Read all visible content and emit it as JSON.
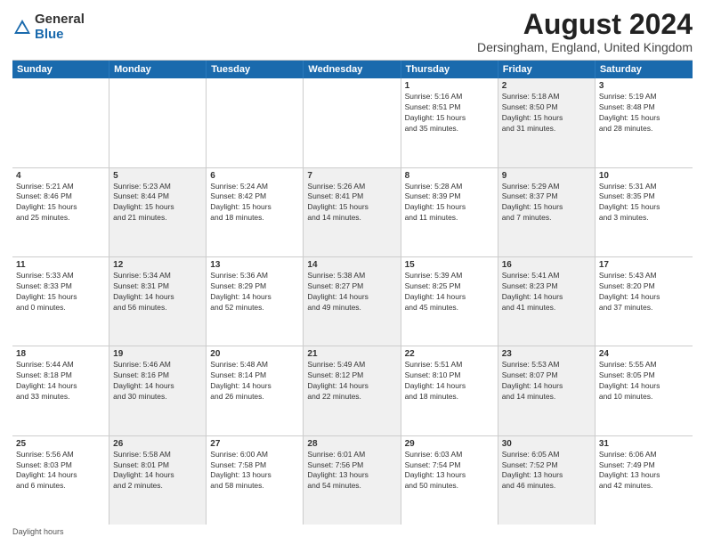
{
  "logo": {
    "general": "General",
    "blue": "Blue"
  },
  "title": "August 2024",
  "subtitle": "Dersingham, England, United Kingdom",
  "daylight_label": "Daylight hours",
  "headers": [
    "Sunday",
    "Monday",
    "Tuesday",
    "Wednesday",
    "Thursday",
    "Friday",
    "Saturday"
  ],
  "rows": [
    [
      {
        "day": "",
        "text": "",
        "alt": false
      },
      {
        "day": "",
        "text": "",
        "alt": false
      },
      {
        "day": "",
        "text": "",
        "alt": false
      },
      {
        "day": "",
        "text": "",
        "alt": false
      },
      {
        "day": "1",
        "text": "Sunrise: 5:16 AM\nSunset: 8:51 PM\nDaylight: 15 hours\nand 35 minutes.",
        "alt": false
      },
      {
        "day": "2",
        "text": "Sunrise: 5:18 AM\nSunset: 8:50 PM\nDaylight: 15 hours\nand 31 minutes.",
        "alt": true
      },
      {
        "day": "3",
        "text": "Sunrise: 5:19 AM\nSunset: 8:48 PM\nDaylight: 15 hours\nand 28 minutes.",
        "alt": false
      }
    ],
    [
      {
        "day": "4",
        "text": "Sunrise: 5:21 AM\nSunset: 8:46 PM\nDaylight: 15 hours\nand 25 minutes.",
        "alt": false
      },
      {
        "day": "5",
        "text": "Sunrise: 5:23 AM\nSunset: 8:44 PM\nDaylight: 15 hours\nand 21 minutes.",
        "alt": true
      },
      {
        "day": "6",
        "text": "Sunrise: 5:24 AM\nSunset: 8:42 PM\nDaylight: 15 hours\nand 18 minutes.",
        "alt": false
      },
      {
        "day": "7",
        "text": "Sunrise: 5:26 AM\nSunset: 8:41 PM\nDaylight: 15 hours\nand 14 minutes.",
        "alt": true
      },
      {
        "day": "8",
        "text": "Sunrise: 5:28 AM\nSunset: 8:39 PM\nDaylight: 15 hours\nand 11 minutes.",
        "alt": false
      },
      {
        "day": "9",
        "text": "Sunrise: 5:29 AM\nSunset: 8:37 PM\nDaylight: 15 hours\nand 7 minutes.",
        "alt": true
      },
      {
        "day": "10",
        "text": "Sunrise: 5:31 AM\nSunset: 8:35 PM\nDaylight: 15 hours\nand 3 minutes.",
        "alt": false
      }
    ],
    [
      {
        "day": "11",
        "text": "Sunrise: 5:33 AM\nSunset: 8:33 PM\nDaylight: 15 hours\nand 0 minutes.",
        "alt": false
      },
      {
        "day": "12",
        "text": "Sunrise: 5:34 AM\nSunset: 8:31 PM\nDaylight: 14 hours\nand 56 minutes.",
        "alt": true
      },
      {
        "day": "13",
        "text": "Sunrise: 5:36 AM\nSunset: 8:29 PM\nDaylight: 14 hours\nand 52 minutes.",
        "alt": false
      },
      {
        "day": "14",
        "text": "Sunrise: 5:38 AM\nSunset: 8:27 PM\nDaylight: 14 hours\nand 49 minutes.",
        "alt": true
      },
      {
        "day": "15",
        "text": "Sunrise: 5:39 AM\nSunset: 8:25 PM\nDaylight: 14 hours\nand 45 minutes.",
        "alt": false
      },
      {
        "day": "16",
        "text": "Sunrise: 5:41 AM\nSunset: 8:23 PM\nDaylight: 14 hours\nand 41 minutes.",
        "alt": true
      },
      {
        "day": "17",
        "text": "Sunrise: 5:43 AM\nSunset: 8:20 PM\nDaylight: 14 hours\nand 37 minutes.",
        "alt": false
      }
    ],
    [
      {
        "day": "18",
        "text": "Sunrise: 5:44 AM\nSunset: 8:18 PM\nDaylight: 14 hours\nand 33 minutes.",
        "alt": false
      },
      {
        "day": "19",
        "text": "Sunrise: 5:46 AM\nSunset: 8:16 PM\nDaylight: 14 hours\nand 30 minutes.",
        "alt": true
      },
      {
        "day": "20",
        "text": "Sunrise: 5:48 AM\nSunset: 8:14 PM\nDaylight: 14 hours\nand 26 minutes.",
        "alt": false
      },
      {
        "day": "21",
        "text": "Sunrise: 5:49 AM\nSunset: 8:12 PM\nDaylight: 14 hours\nand 22 minutes.",
        "alt": true
      },
      {
        "day": "22",
        "text": "Sunrise: 5:51 AM\nSunset: 8:10 PM\nDaylight: 14 hours\nand 18 minutes.",
        "alt": false
      },
      {
        "day": "23",
        "text": "Sunrise: 5:53 AM\nSunset: 8:07 PM\nDaylight: 14 hours\nand 14 minutes.",
        "alt": true
      },
      {
        "day": "24",
        "text": "Sunrise: 5:55 AM\nSunset: 8:05 PM\nDaylight: 14 hours\nand 10 minutes.",
        "alt": false
      }
    ],
    [
      {
        "day": "25",
        "text": "Sunrise: 5:56 AM\nSunset: 8:03 PM\nDaylight: 14 hours\nand 6 minutes.",
        "alt": false
      },
      {
        "day": "26",
        "text": "Sunrise: 5:58 AM\nSunset: 8:01 PM\nDaylight: 14 hours\nand 2 minutes.",
        "alt": true
      },
      {
        "day": "27",
        "text": "Sunrise: 6:00 AM\nSunset: 7:58 PM\nDaylight: 13 hours\nand 58 minutes.",
        "alt": false
      },
      {
        "day": "28",
        "text": "Sunrise: 6:01 AM\nSunset: 7:56 PM\nDaylight: 13 hours\nand 54 minutes.",
        "alt": true
      },
      {
        "day": "29",
        "text": "Sunrise: 6:03 AM\nSunset: 7:54 PM\nDaylight: 13 hours\nand 50 minutes.",
        "alt": false
      },
      {
        "day": "30",
        "text": "Sunrise: 6:05 AM\nSunset: 7:52 PM\nDaylight: 13 hours\nand 46 minutes.",
        "alt": true
      },
      {
        "day": "31",
        "text": "Sunrise: 6:06 AM\nSunset: 7:49 PM\nDaylight: 13 hours\nand 42 minutes.",
        "alt": false
      }
    ]
  ]
}
